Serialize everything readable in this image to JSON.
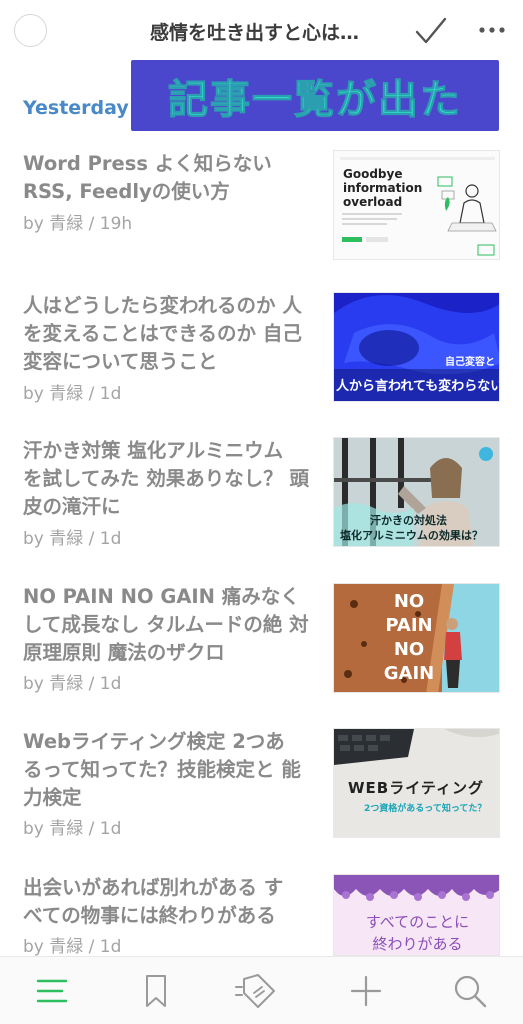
{
  "header": {
    "title": "感情を吐き出すと心は…",
    "done_icon": "checkmark-icon",
    "more_icon": "more-dots-icon"
  },
  "overlay": {
    "text": "記事一覧が出た"
  },
  "section": {
    "label": "Yesterday"
  },
  "articles": [
    {
      "title": "Word Press よく知らない RSS, Feedlyの使い方",
      "meta": "by 青緑 / 19h",
      "thumb": {
        "headline": "Goodbye information overload"
      }
    },
    {
      "title": "人はどうしたら変われるのか 人を変えることはできるのか 自己変容について思うこと",
      "meta": "by 青緑 / 1d",
      "thumb": {
        "caption_top": "自己変容と",
        "caption": "人から言われても変わらない"
      }
    },
    {
      "title": "汗かき対策 塩化アルミニウム を試してみた 効果ありなし？ 頭皮の滝汗に",
      "meta": "by 青緑 / 1d",
      "thumb": {
        "caption_line1": "汗かきの対処法",
        "caption_line2": "塩化アルミニウムの効果は？"
      }
    },
    {
      "title": "NO PAIN NO GAIN 痛みなく して成長なし タルムードの絶 対原理原則 魔法のザクロ",
      "meta": "by 青緑 / 1d",
      "thumb": {
        "line1": "NO",
        "line2": "PAIN",
        "line3": "NO",
        "line4": "GAIN"
      }
    },
    {
      "title": "Webライティング検定 2つあ るって知ってた？技能検定と 能力検定",
      "meta": "by 青緑 / 1d",
      "thumb": {
        "heading": "WEBライティング",
        "sub": "2つ資格があるって知ってた？"
      }
    },
    {
      "title": "出会いがあれば別れがある す べての物事には終わりがある",
      "meta": "by 青緑 / 1d",
      "thumb": {
        "line1": "すべてのことに",
        "line2": "終わりがある"
      }
    }
  ],
  "bottom_nav": {
    "items": [
      "list-icon",
      "bookmark-icon",
      "explore-tag-icon",
      "add-icon",
      "search-icon"
    ],
    "active_color": "#2dbe60"
  }
}
